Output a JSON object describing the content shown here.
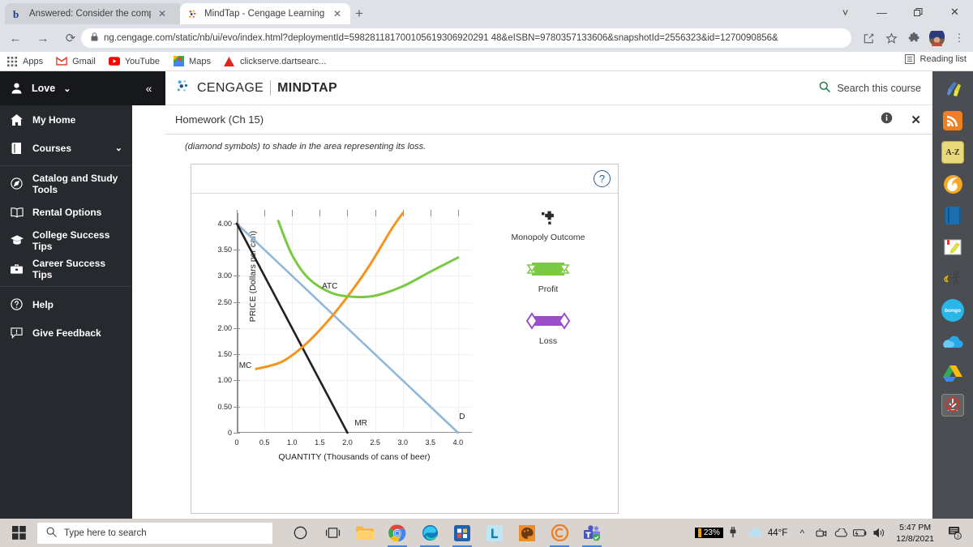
{
  "browser": {
    "tabs": [
      {
        "title": "Answered: Consider the competi",
        "favicon": "bartleby-b-icon",
        "active": false
      },
      {
        "title": "MindTap - Cengage Learning",
        "favicon": "cengage-icon",
        "active": true
      }
    ],
    "new_tab_label": "+",
    "window_controls": [
      "chevron-down",
      "minimize",
      "restore",
      "close"
    ],
    "nav": {
      "back": "←",
      "forward": "→",
      "reload": "⟳"
    },
    "omnibox": {
      "url": "ng.cengage.com/static/nb/ui/evo/index.html?deploymentId=598281181700105619306920291 48&eISBN=9780357133606&snapshotId=2556323&id=1270090856&",
      "lock": "🔒"
    },
    "bookmarks": [
      {
        "label": "Apps",
        "icon": "apps-grid-icon"
      },
      {
        "label": "Gmail",
        "icon": "gmail-icon"
      },
      {
        "label": "YouTube",
        "icon": "youtube-icon"
      },
      {
        "label": "Maps",
        "icon": "maps-icon"
      },
      {
        "label": "clickserve.dartsearc...",
        "icon": "adobe-icon"
      }
    ],
    "reading_list": "Reading list"
  },
  "sidebar": {
    "user": {
      "label": "Love",
      "icon": "person-icon",
      "caret": "⌄"
    },
    "collapse": "«",
    "items": [
      {
        "label": "My Home",
        "icon": "home-icon"
      },
      {
        "label": "Courses",
        "icon": "book-icon",
        "caret": "⌄"
      },
      {
        "label": "Catalog and Study Tools",
        "icon": "compass-icon"
      },
      {
        "label": "Rental Options",
        "icon": "open-book-icon"
      },
      {
        "label": "College Success Tips",
        "icon": "graduation-cap-icon"
      },
      {
        "label": "Career Success Tips",
        "icon": "briefcase-icon"
      },
      {
        "label": "Help",
        "icon": "question-circle-icon"
      },
      {
        "label": "Give Feedback",
        "icon": "feedback-icon"
      }
    ]
  },
  "mindtap": {
    "brand_primary": "CENGAGE",
    "brand_secondary": "MINDTAP",
    "search_label": "Search this course",
    "help_label": "?",
    "homework_title": "Homework (Ch 15)",
    "info_label": "i",
    "close_label": "✕",
    "prompt": "(diamond symbols) to shade in the area representing its loss.",
    "card_help": "?"
  },
  "chart_data": {
    "type": "line",
    "title": "",
    "xlabel": "QUANTITY (Thousands of cans of beer)",
    "ylabel": "PRICE (Dollars per can)",
    "xlim": [
      0,
      4.25
    ],
    "ylim": [
      0,
      4.2
    ],
    "xticks": [
      "0",
      "0.5",
      "1.0",
      "1.5",
      "2.0",
      "2.5",
      "3.0",
      "3.5",
      "4.0"
    ],
    "yticks": [
      "0",
      "0.50",
      "1.00",
      "1.50",
      "2.00",
      "2.50",
      "3.00",
      "3.50",
      "4.00"
    ],
    "grid": true,
    "series": [
      {
        "name": "D",
        "label": "D",
        "color": "#8fb8d8",
        "type": "line",
        "points": [
          [
            0,
            4.0
          ],
          [
            4.0,
            0
          ]
        ]
      },
      {
        "name": "MR",
        "label": "MR",
        "color": "#231f20",
        "type": "line",
        "points": [
          [
            0,
            4.0
          ],
          [
            2.0,
            0
          ]
        ]
      },
      {
        "name": "MC",
        "label": "MC",
        "color": "#f7941e",
        "type": "curve",
        "points": [
          [
            0.35,
            1.22
          ],
          [
            0.8,
            1.35
          ],
          [
            1.2,
            1.65
          ],
          [
            1.6,
            2.08
          ],
          [
            2.0,
            2.6
          ],
          [
            2.4,
            3.2
          ],
          [
            2.8,
            3.9
          ],
          [
            3.0,
            4.2
          ]
        ]
      },
      {
        "name": "ATC",
        "label": "ATC",
        "color": "#7ac943",
        "type": "curve",
        "points": [
          [
            0.75,
            4.05
          ],
          [
            1.0,
            3.4
          ],
          [
            1.3,
            2.95
          ],
          [
            1.7,
            2.68
          ],
          [
            2.1,
            2.6
          ],
          [
            2.5,
            2.62
          ],
          [
            3.0,
            2.8
          ],
          [
            3.5,
            3.08
          ],
          [
            4.0,
            3.35
          ]
        ]
      }
    ]
  },
  "legend": {
    "items": [
      {
        "label": "Monopoly Outcome",
        "symbol": "black-cross-marker",
        "color": "#2b2b2b"
      },
      {
        "label": "Profit",
        "symbol": "green-triangle-bar",
        "color": "#7ac943"
      },
      {
        "label": "Loss",
        "symbol": "purple-diamond-bar",
        "color": "#9b4ec9"
      }
    ]
  },
  "rail": {
    "items": [
      {
        "name": "highlighter-pen-icon"
      },
      {
        "name": "rss-feed-icon"
      },
      {
        "name": "a-z-dictionary-icon"
      },
      {
        "name": "six-spiral-icon"
      },
      {
        "name": "blue-book-icon"
      },
      {
        "name": "notes-highlight-icon"
      },
      {
        "name": "read-aloud-icon"
      },
      {
        "name": "bongo-icon"
      },
      {
        "name": "onedrive-cloud-icon"
      },
      {
        "name": "google-drive-icon"
      },
      {
        "name": "download-blocked-icon"
      }
    ],
    "az_label": "A-Z",
    "bongo_label": "bongo"
  },
  "taskbar": {
    "search_placeholder": "Type here to search",
    "apps": [
      {
        "name": "cortana-icon"
      },
      {
        "name": "task-view-icon"
      },
      {
        "name": "file-explorer-icon"
      },
      {
        "name": "chrome-icon",
        "running": true
      },
      {
        "name": "edge-icon",
        "running": true
      },
      {
        "name": "microsoft-store-icon",
        "running": true
      },
      {
        "name": "lastpass-icon"
      },
      {
        "name": "paint-icon"
      },
      {
        "name": "cengage-icon",
        "running": true
      },
      {
        "name": "teams-icon",
        "running": true
      }
    ],
    "battery_percent": "23%",
    "temperature": "44°F",
    "time": "5:47 PM",
    "date": "12/8/2021",
    "notification_count": "3"
  }
}
